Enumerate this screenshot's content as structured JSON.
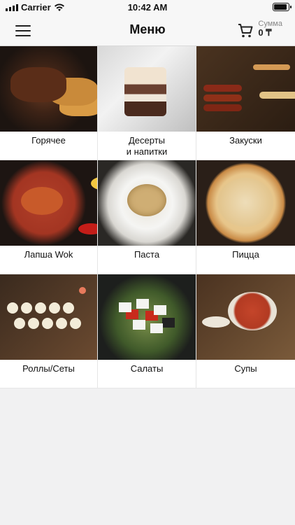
{
  "status_bar": {
    "carrier": "Carrier",
    "time": "10:42 AM",
    "wifi_icon": "wifi-icon",
    "battery_icon": "battery-icon"
  },
  "nav": {
    "title": "Меню",
    "menu_icon": "hamburger-menu-icon",
    "cart_icon": "shopping-cart-icon",
    "sum_label": "Сумма",
    "sum_value": "0 ₸"
  },
  "categories": [
    {
      "label": "Горячее",
      "image": "hot-dishes-image"
    },
    {
      "label": "Десерты\nи напитки",
      "image": "desserts-image"
    },
    {
      "label": "Закуски",
      "image": "snacks-image"
    },
    {
      "label": "Лапша Wok",
      "image": "wok-noodles-image"
    },
    {
      "label": "Паста",
      "image": "pasta-image"
    },
    {
      "label": "Пицца",
      "image": "pizza-image"
    },
    {
      "label": "Роллы/Сеты",
      "image": "rolls-image"
    },
    {
      "label": "Салаты",
      "image": "salads-image"
    },
    {
      "label": "Супы",
      "image": "soups-image"
    }
  ]
}
